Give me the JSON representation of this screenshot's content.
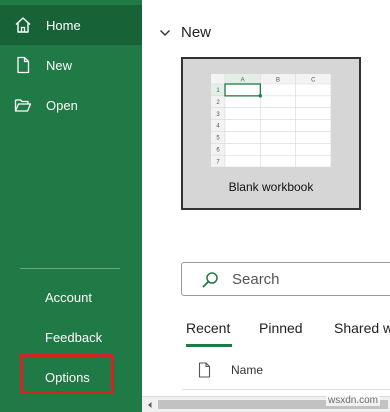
{
  "sidebar": {
    "items": [
      {
        "label": "Home",
        "icon": "home-icon"
      },
      {
        "label": "New",
        "icon": "new-document-icon"
      },
      {
        "label": "Open",
        "icon": "open-folder-icon"
      }
    ],
    "bottom_items": [
      {
        "label": "Account"
      },
      {
        "label": "Feedback"
      },
      {
        "label": "Options"
      }
    ],
    "active_item": "Home",
    "highlighted_item": "Options"
  },
  "main": {
    "new_section_title": "New",
    "templates": [
      {
        "label": "Blank workbook",
        "columns": [
          "A",
          "B",
          "C"
        ],
        "rows": [
          "1",
          "2",
          "3",
          "4",
          "5",
          "6",
          "7"
        ]
      }
    ],
    "search": {
      "placeholder": "Search"
    },
    "tabs": [
      {
        "label": "Recent",
        "selected": true
      },
      {
        "label": "Pinned",
        "selected": false
      },
      {
        "label": "Shared w",
        "selected": false
      }
    ],
    "file_list_header": {
      "name": "Name"
    }
  },
  "watermark": "wsxdn.com",
  "colors": {
    "sidebar_bg": "#1f7a46",
    "sidebar_active": "#176337",
    "highlight_border": "#d22424",
    "accent": "#1f7a46"
  }
}
